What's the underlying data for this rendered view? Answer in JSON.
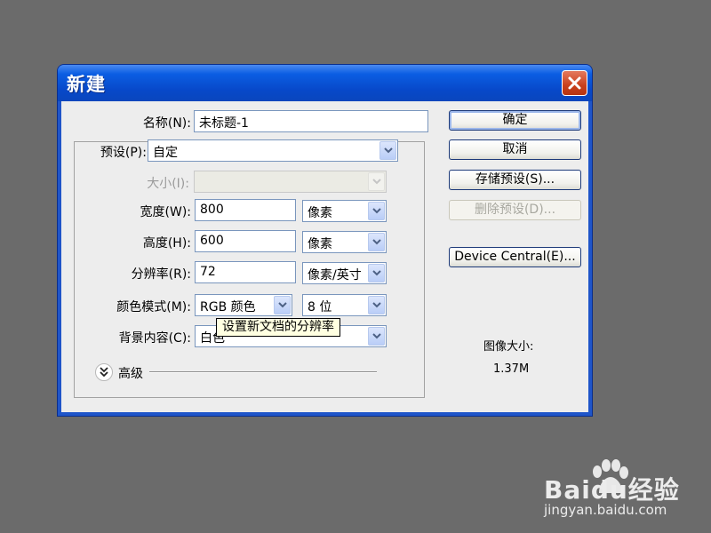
{
  "dialog": {
    "title": "新建",
    "close_icon": "close-icon"
  },
  "fields": {
    "name_label": "名称(N):",
    "name_value": "未标题-1",
    "preset_label": "预设(P):",
    "preset_value": "自定",
    "size_label": "大小(I):",
    "size_value": "",
    "width_label": "宽度(W):",
    "width_value": "800",
    "width_unit": "像素",
    "height_label": "高度(H):",
    "height_value": "600",
    "height_unit": "像素",
    "resolution_label": "分辨率(R):",
    "resolution_value": "72",
    "resolution_unit": "像素/英寸",
    "color_mode_label": "颜色模式(M):",
    "color_mode_value": "RGB 颜色",
    "bit_depth_value": "8 位",
    "background_label": "背景内容(C):",
    "background_value": "白色",
    "advanced_label": "高级"
  },
  "tooltip": "设置新文档的分辨率",
  "buttons": {
    "ok": "确定",
    "cancel": "取消",
    "save_preset": "存储预设(S)...",
    "delete_preset": "删除预设(D)...",
    "device_central": "Device Central(E)..."
  },
  "image_size": {
    "label": "图像大小:",
    "value": "1.37M"
  },
  "watermark": {
    "brand": "Baidu经验",
    "url": "jingyan.baidu.com"
  }
}
